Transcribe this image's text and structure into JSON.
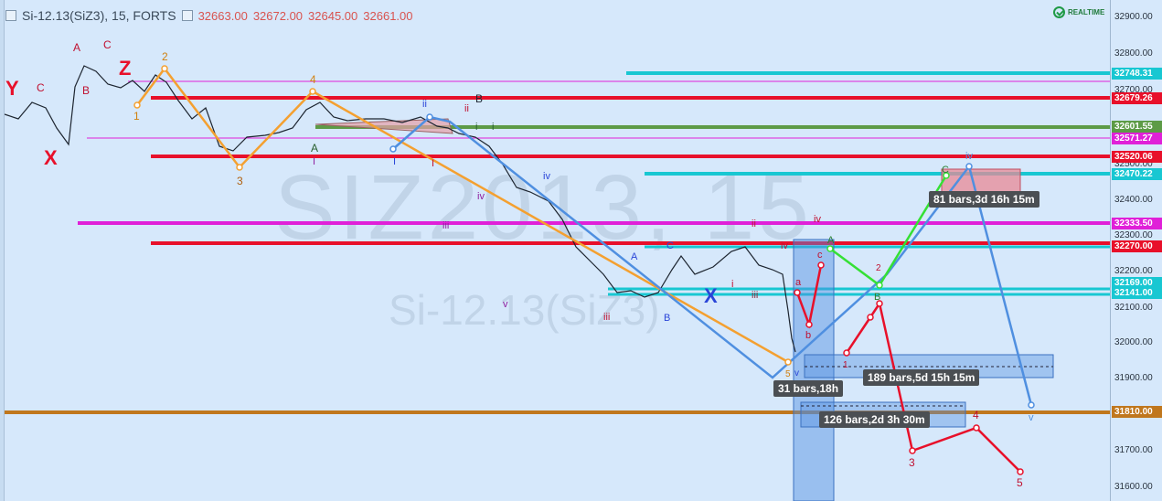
{
  "legend": {
    "symbol": "Si-12.13(SiZ3), 15, FORTS",
    "open": "32663.00",
    "high": "32672.00",
    "low": "32645.00",
    "close": "32661.00"
  },
  "realtime_label": "REALTIME",
  "watermark": {
    "big": "SIZ2013, 15",
    "small": "Si-12.13(SiZ3)"
  },
  "axis_ticks": [
    "32900.00",
    "32800.00",
    "32700.00",
    "32600.00",
    "32500.00",
    "32400.00",
    "32300.00",
    "32200.00",
    "32100.00",
    "32000.00",
    "31900.00",
    "31800.00",
    "31700.00",
    "31600.00"
  ],
  "price_tags": [
    {
      "text": "32748.31",
      "color": "#18c7d2"
    },
    {
      "text": "32679.26",
      "color": "#e8102a"
    },
    {
      "text": "32601.55",
      "color": "#5d9b46"
    },
    {
      "text": "32571.27",
      "color": "#e020d8"
    },
    {
      "text": "32520.06",
      "color": "#e8102a"
    },
    {
      "text": "32470.22",
      "color": "#18c7d2"
    },
    {
      "text": "32333.50",
      "color": "#e020d8"
    },
    {
      "text": "32270.00",
      "color": "#e8102a"
    },
    {
      "text": "32169.00",
      "color": "#18c7d2"
    },
    {
      "text": "32141.00",
      "color": "#18c7d2"
    },
    {
      "text": "31810.00",
      "color": "#c0771d"
    }
  ],
  "callouts": {
    "c1": "81 bars,3d 16h 15m",
    "c2": "189 bars,5d 15h 15m",
    "c3": "31 bars,18h",
    "c4": "126 bars,2d 3h 30m"
  },
  "wave_labels": {
    "Y": "Y",
    "X1": "X",
    "Z": "Z",
    "X2": "X",
    "A1": "A",
    "C1": "C",
    "B1": "B",
    "C2": "C",
    "w2": "2",
    "w1": "1",
    "w3": "3",
    "w4": "4",
    "Aa": "A",
    "Bb": "B",
    "ii1": "ii",
    "i1": "i",
    "ii2": "ii",
    "i2": "i",
    "I1": "I",
    "I2": "I",
    "I3": "I",
    "iv1": "iv",
    "iii1": "iii",
    "iv2": "iv",
    "v1": "v",
    "A2": "A",
    "C3": "C",
    "B2": "B",
    "iii2": "iii",
    "ii3": "ii",
    "iv3": "iv",
    "iv4": "iv",
    "i3": "i",
    "iii3": "iii",
    "a1": "a",
    "b1": "b",
    "c1": "c",
    "A3": "A",
    "v2": "v",
    "s5": "5",
    "s1": "1",
    "s2": "2",
    "s3": "3",
    "s4": "4",
    "s5b": "5",
    "C4": "C",
    "B3": "B",
    "iv5": "iv",
    "v3": "v"
  },
  "colors": {
    "red": "#e8102a",
    "cyan": "#18c7d2",
    "magenta": "#e020d8",
    "green": "#5d9b46",
    "orange": "#f4a030",
    "blue": "#4f8fe0",
    "brown": "#c0771d",
    "lime": "#35e035"
  }
}
